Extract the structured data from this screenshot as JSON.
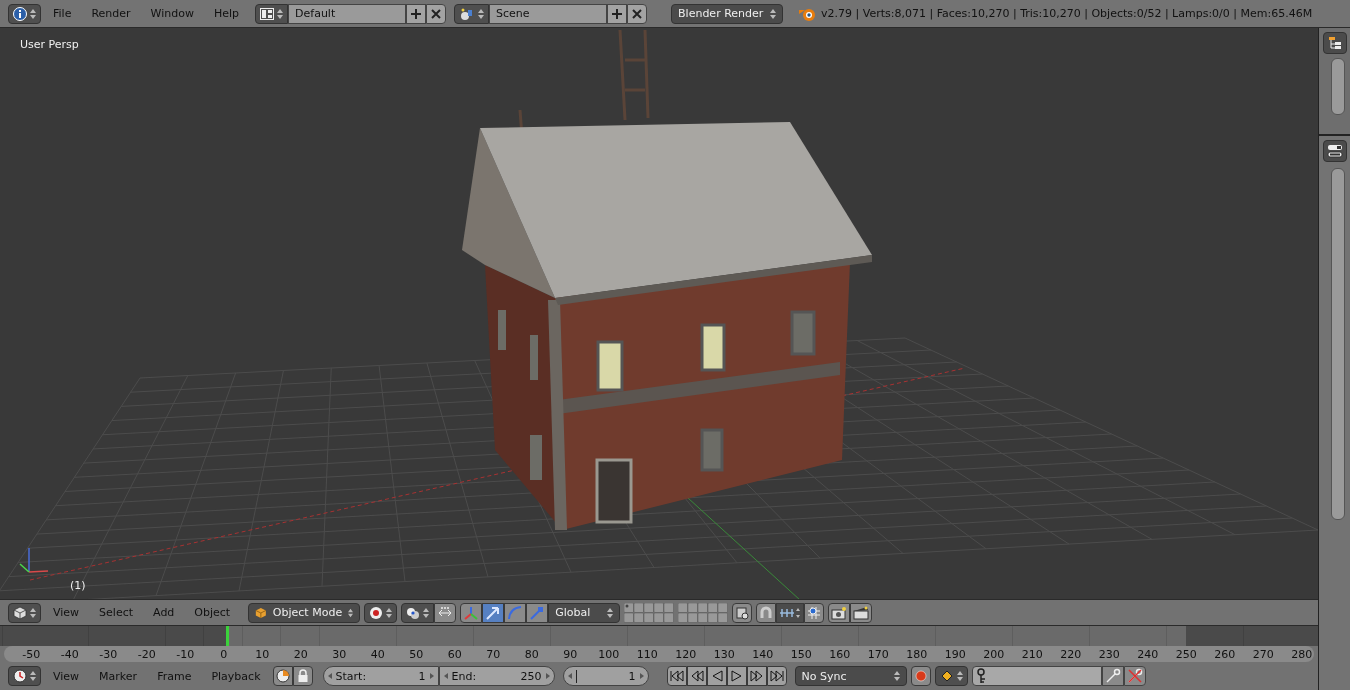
{
  "top_bar": {
    "menus": [
      "File",
      "Render",
      "Window",
      "Help"
    ],
    "screen_layout": "Default",
    "scene": "Scene",
    "render_engine": "Blender Render",
    "stats": "v2.79 | Verts:8,071 | Faces:10,270 | Tris:10,270 | Objects:0/52 | Lamps:0/0 | Mem:65.46M"
  },
  "viewport": {
    "view_label": "User Persp",
    "frame_label": "(1)"
  },
  "view3d_header": {
    "menus": [
      "View",
      "Select",
      "Add",
      "Object"
    ],
    "mode": "Object Mode",
    "manipulators": [
      {
        "kind": "axes",
        "selected": false
      },
      {
        "kind": "translate",
        "selected": true
      },
      {
        "kind": "rotate",
        "selected": false
      },
      {
        "kind": "scale",
        "selected": false
      }
    ],
    "orientation": "Global"
  },
  "timeline": {
    "ticks": [
      "-50",
      "-40",
      "-30",
      "-20",
      "-10",
      "0",
      "10",
      "20",
      "30",
      "40",
      "50",
      "60",
      "70",
      "80",
      "90",
      "100",
      "110",
      "120",
      "130",
      "140",
      "150",
      "160",
      "170",
      "180",
      "190",
      "200",
      "210",
      "220",
      "230",
      "240",
      "250",
      "260",
      "270",
      "280"
    ]
  },
  "timeline_header": {
    "menus": [
      "View",
      "Marker",
      "Frame",
      "Playback"
    ],
    "start_label": "Start:",
    "start": "1",
    "end_label": "End:",
    "end": "250",
    "current_frame": "1",
    "sync": "No Sync",
    "recording": false
  }
}
